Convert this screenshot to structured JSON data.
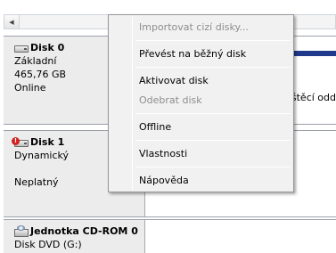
{
  "context_menu": {
    "items": [
      {
        "label": "Importovat cizí disky...",
        "enabled": false
      },
      {
        "label": "Převést na běžný disk",
        "enabled": true
      },
      {
        "label": "Aktivovat disk",
        "enabled": true
      },
      {
        "label": "Odebrat disk",
        "enabled": false
      },
      {
        "label": "Offline",
        "enabled": true
      },
      {
        "label": "Vlastnosti",
        "enabled": true
      },
      {
        "label": "Nápověda",
        "enabled": true
      }
    ]
  },
  "disks": [
    {
      "name": "Disk 0",
      "type": "Základní",
      "size": "465,76 GB",
      "status": "Online",
      "icon": "hard-disk-icon",
      "partition_text": "štěcí odd"
    },
    {
      "name": "Disk 1",
      "type": "Dynamický",
      "status": "Neplatný",
      "icon": "hard-disk-warning-icon"
    },
    {
      "name": "Jednotka CD-ROM 0",
      "type": "Disk DVD (G:)",
      "icon": "cd-rom-icon"
    }
  ],
  "colors": {
    "partition_bar": "#1f3a8a",
    "info_panel": "#ececec",
    "menu_background": "#f1f1f1",
    "disabled_text": "#8d8d8d"
  }
}
